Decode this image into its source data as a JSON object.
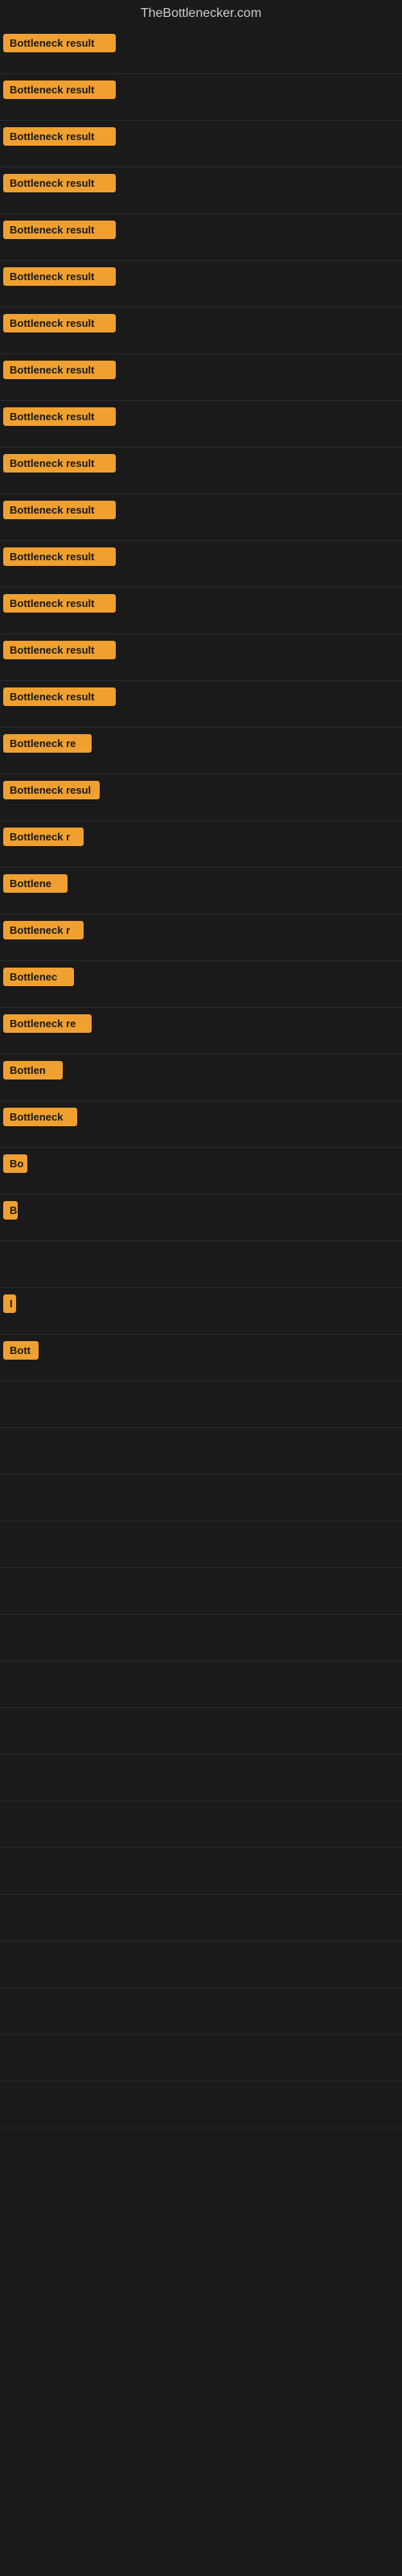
{
  "site": {
    "title": "TheBottlenecker.com"
  },
  "items": [
    {
      "id": 1,
      "label": "Bottleneck result",
      "width": 140
    },
    {
      "id": 2,
      "label": "Bottleneck result",
      "width": 140
    },
    {
      "id": 3,
      "label": "Bottleneck result",
      "width": 140
    },
    {
      "id": 4,
      "label": "Bottleneck result",
      "width": 140
    },
    {
      "id": 5,
      "label": "Bottleneck result",
      "width": 140
    },
    {
      "id": 6,
      "label": "Bottleneck result",
      "width": 140
    },
    {
      "id": 7,
      "label": "Bottleneck result",
      "width": 140
    },
    {
      "id": 8,
      "label": "Bottleneck result",
      "width": 140
    },
    {
      "id": 9,
      "label": "Bottleneck result",
      "width": 140
    },
    {
      "id": 10,
      "label": "Bottleneck result",
      "width": 140
    },
    {
      "id": 11,
      "label": "Bottleneck result",
      "width": 140
    },
    {
      "id": 12,
      "label": "Bottleneck result",
      "width": 140
    },
    {
      "id": 13,
      "label": "Bottleneck result",
      "width": 140
    },
    {
      "id": 14,
      "label": "Bottleneck result",
      "width": 140
    },
    {
      "id": 15,
      "label": "Bottleneck result",
      "width": 140
    },
    {
      "id": 16,
      "label": "Bottleneck re",
      "width": 110
    },
    {
      "id": 17,
      "label": "Bottleneck resul",
      "width": 120
    },
    {
      "id": 18,
      "label": "Bottleneck r",
      "width": 100
    },
    {
      "id": 19,
      "label": "Bottlene",
      "width": 80
    },
    {
      "id": 20,
      "label": "Bottleneck r",
      "width": 100
    },
    {
      "id": 21,
      "label": "Bottlenec",
      "width": 88
    },
    {
      "id": 22,
      "label": "Bottleneck re",
      "width": 110
    },
    {
      "id": 23,
      "label": "Bottlen",
      "width": 74
    },
    {
      "id": 24,
      "label": "Bottleneck",
      "width": 92
    },
    {
      "id": 25,
      "label": "Bo",
      "width": 30
    },
    {
      "id": 26,
      "label": "B",
      "width": 18
    },
    {
      "id": 27,
      "label": "",
      "width": 10
    },
    {
      "id": 28,
      "label": "I",
      "width": 10
    },
    {
      "id": 29,
      "label": "Bott",
      "width": 44
    },
    {
      "id": 30,
      "label": "",
      "width": 0
    },
    {
      "id": 31,
      "label": "",
      "width": 0
    },
    {
      "id": 32,
      "label": "",
      "width": 0
    },
    {
      "id": 33,
      "label": "",
      "width": 0
    }
  ]
}
